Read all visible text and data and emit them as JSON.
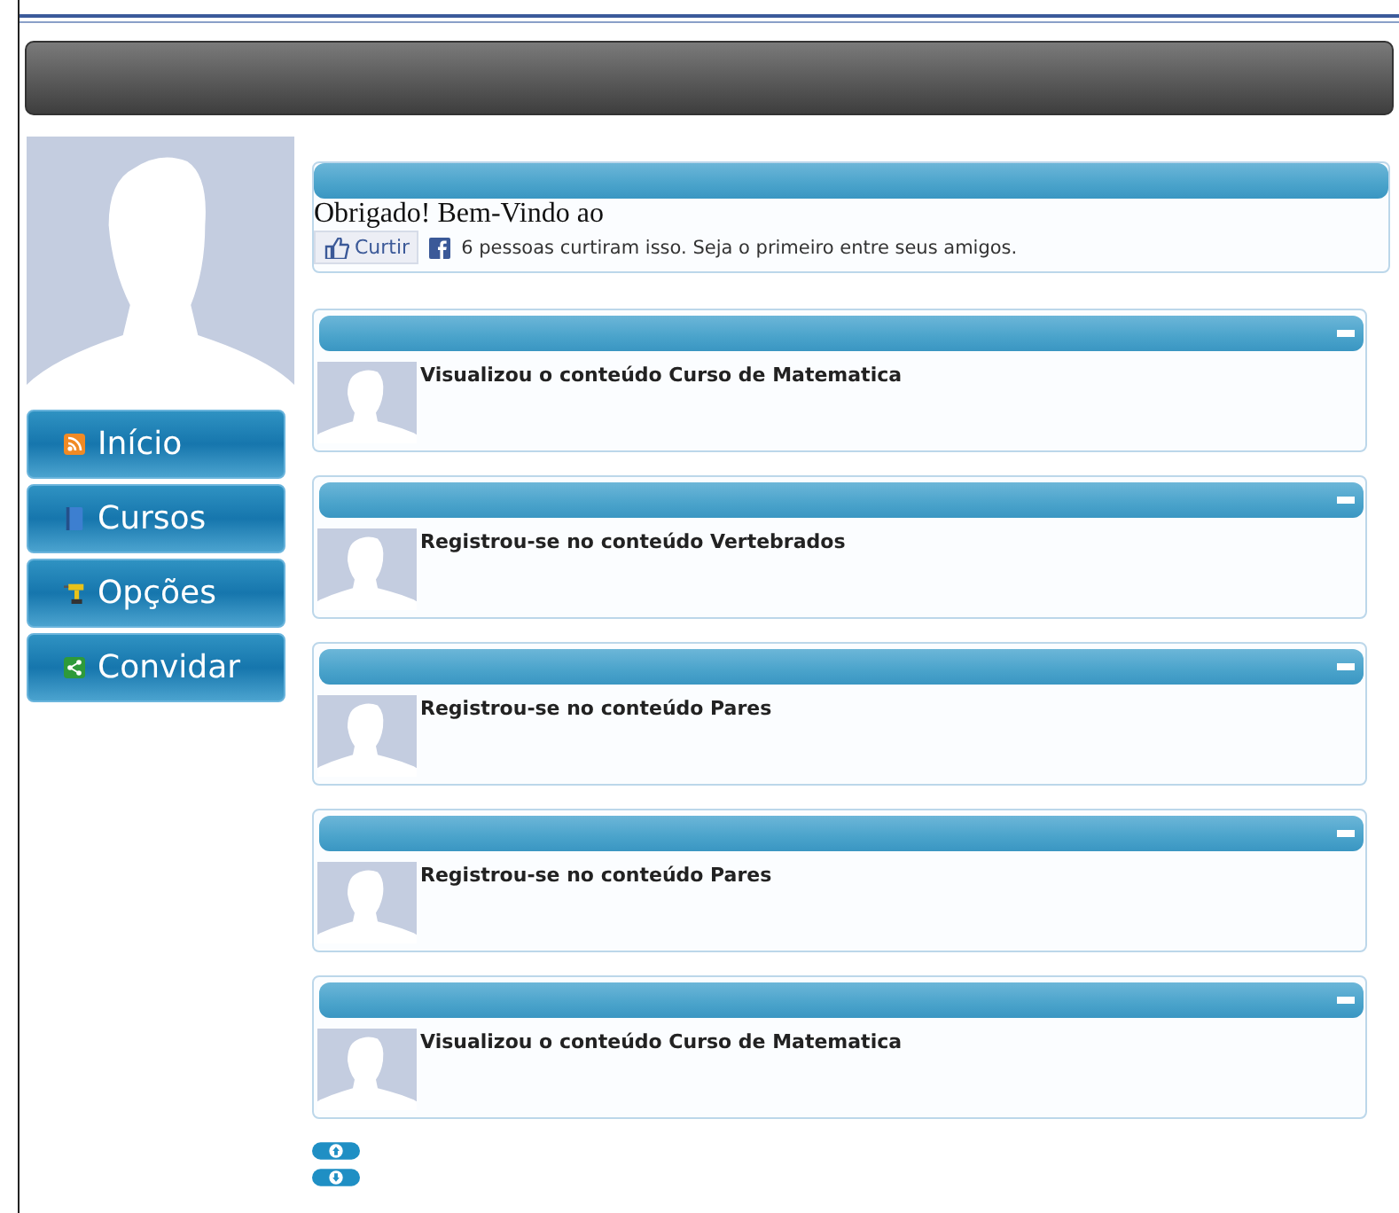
{
  "menu": [
    {
      "label": "Início",
      "kind": "rss"
    },
    {
      "label": "Cursos",
      "kind": "book"
    },
    {
      "label": "Opções",
      "kind": "drill"
    },
    {
      "label": "Convidar",
      "kind": "share"
    }
  ],
  "welcome": {
    "text": "Obrigado! Bem-Vindo ao",
    "like_button": "Curtir",
    "like_text": "6 pessoas curtiram isso. Seja o primeiro entre seus amigos."
  },
  "feed": [
    {
      "text": "Visualizou o conteúdo Curso de Matematica"
    },
    {
      "text": "Registrou-se no conteúdo Vertebrados"
    },
    {
      "text": "Registrou-se no conteúdo Pares"
    },
    {
      "text": "Registrou-se no conteúdo Pares"
    },
    {
      "text": "Visualizou o conteúdo Curso de Matematica"
    }
  ]
}
